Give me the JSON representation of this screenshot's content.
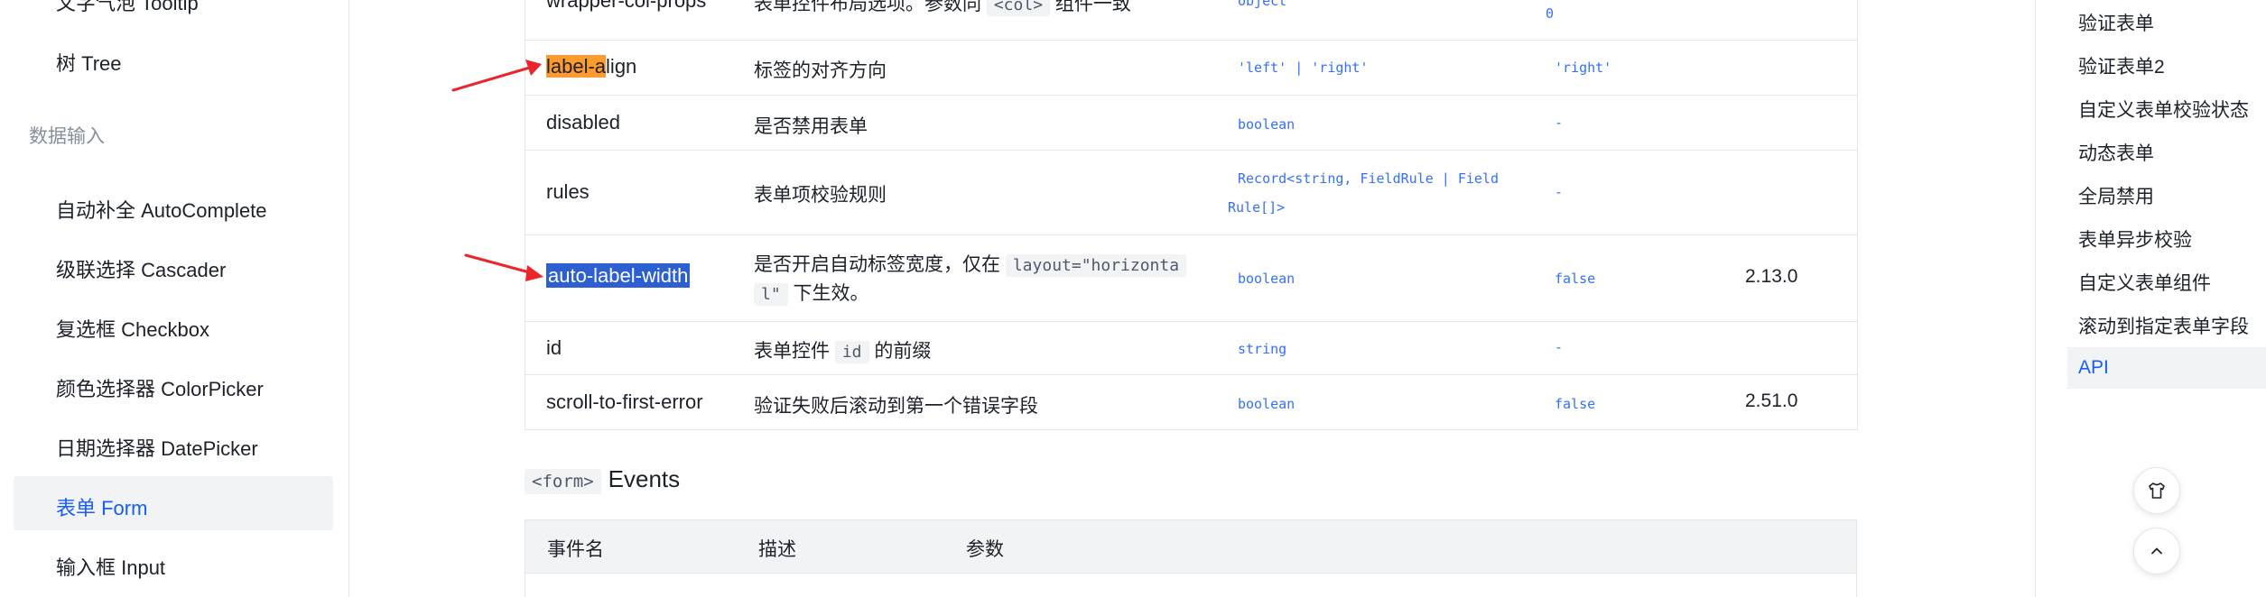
{
  "sidebar": {
    "items_top": [
      {
        "label": "文字气泡 Tooltip"
      },
      {
        "label": "树 Tree"
      }
    ],
    "group_label": "数据输入",
    "items": [
      {
        "label": "自动补全 AutoComplete"
      },
      {
        "label": "级联选择 Cascader"
      },
      {
        "label": "复选框 Checkbox"
      },
      {
        "label": "颜色选择器 ColorPicker"
      },
      {
        "label": "日期选择器 DatePicker"
      },
      {
        "label": "表单 Form",
        "active": true
      },
      {
        "label": "输入框 Input"
      }
    ]
  },
  "api_table": {
    "rows": [
      {
        "name": "wrapper-col-props",
        "desc_a": "表单控件布局选项。参数同",
        "desc_code": "<col>",
        "desc_b": "组件一致",
        "type": "object",
        "default": "0",
        "version": ""
      },
      {
        "name_hl": "label-a",
        "name_rest": "lign",
        "desc": "标签的对齐方向",
        "type": "'left' | 'right'",
        "default": "'right'",
        "version": ""
      },
      {
        "name": "disabled",
        "desc": "是否禁用表单",
        "type": "boolean",
        "default": "-",
        "version": ""
      },
      {
        "name": "rules",
        "desc": "表单项校验规则",
        "type_a": "Record<string, FieldRule | Field",
        "type_b": "Rule[]>",
        "default": "-",
        "version": ""
      },
      {
        "name": "auto-label-width",
        "desc_a": "是否开启自动标签宽度，仅在",
        "desc_code_a": "layout=\"horizonta",
        "desc_code_b": "l\"",
        "desc_b": "下生效。",
        "type": "boolean",
        "default": "false",
        "version": "2.13.0"
      },
      {
        "name": "id",
        "desc_a": "表单控件",
        "desc_code": "id",
        "desc_b": "的前缀",
        "type": "string",
        "default": "-",
        "version": ""
      },
      {
        "name": "scroll-to-first-error",
        "desc": "验证失败后滚动到第一个错误字段",
        "type": "boolean",
        "default": "false",
        "version": "2.51.0"
      }
    ]
  },
  "events": {
    "tag": "<form>",
    "title": "Events",
    "columns": [
      "事件名",
      "描述",
      "参数"
    ]
  },
  "toc": {
    "items": [
      {
        "label": "验证表单"
      },
      {
        "label": "验证表单2"
      },
      {
        "label": "自定义表单校验状态"
      },
      {
        "label": "动态表单"
      },
      {
        "label": "全局禁用"
      },
      {
        "label": "表单异步校验"
      },
      {
        "label": "自定义表单组件"
      },
      {
        "label": "滚动到指定表单字段"
      },
      {
        "label": "API",
        "active": true
      }
    ]
  },
  "colors": {
    "accent": "#165dff",
    "code_blue": "#3370ff",
    "highlight_orange": "#ff9a2e",
    "selection_blue": "#2c5fcf",
    "arrow_red": "#e8262b"
  },
  "icons": {
    "float_top": "tshirt-icon",
    "float_bottom": "chevron-up-icon"
  }
}
